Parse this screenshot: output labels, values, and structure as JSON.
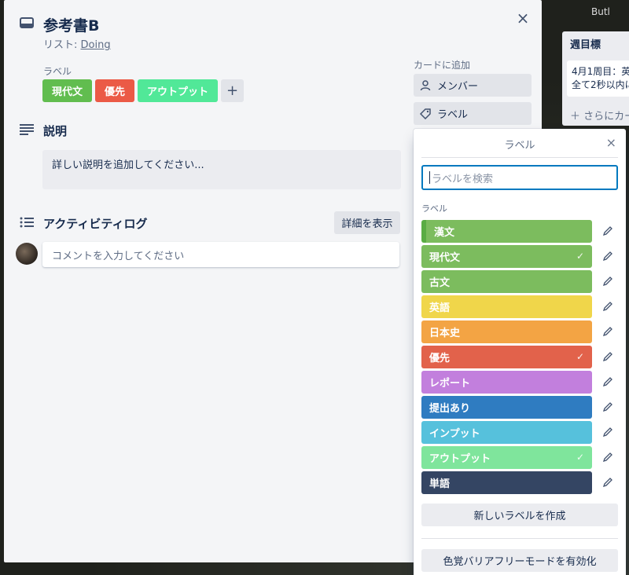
{
  "background": {
    "butler": "Butl",
    "list": {
      "title": "週目標",
      "card_text": "4月1周目：英\n全て2秒以内に",
      "add_card": "＋ さらにカー"
    }
  },
  "card": {
    "title": "参考書B",
    "list_prefix": "リスト: ",
    "list_name": "Doing",
    "labels_heading": "ラベル",
    "labels": [
      {
        "name": "現代文",
        "color": "#61bd4f"
      },
      {
        "name": "優先",
        "color": "#eb5a46"
      },
      {
        "name": "アウトプット",
        "color": "#51e898"
      }
    ],
    "add_label_symbol": "+",
    "description_title": "説明",
    "description_placeholder": "詳しい説明を追加してください...",
    "activity_title": "アクティビティログ",
    "show_details": "詳細を表示",
    "comment_placeholder": "コメントを入力してください",
    "close_symbol": "×"
  },
  "sidebar": {
    "heading": "カードに追加",
    "members": "メンバー",
    "labels": "ラベル"
  },
  "label_popover": {
    "title": "ラベル",
    "close_symbol": "×",
    "search_placeholder": "ラベルを検索",
    "section_heading": "ラベル",
    "items": [
      {
        "name": "漢文",
        "color": "#7cbc5e",
        "checked": false,
        "hovered": true
      },
      {
        "name": "現代文",
        "color": "#7cbc5e",
        "checked": true
      },
      {
        "name": "古文",
        "color": "#7cbc5e",
        "checked": false
      },
      {
        "name": "英語",
        "color": "#f0d64a",
        "checked": false
      },
      {
        "name": "日本史",
        "color": "#f3a444",
        "checked": false
      },
      {
        "name": "優先",
        "color": "#e2624b",
        "checked": true
      },
      {
        "name": "レポート",
        "color": "#c27fdd",
        "checked": false
      },
      {
        "name": "提出あり",
        "color": "#2f7cc1",
        "checked": false
      },
      {
        "name": "インプット",
        "color": "#56c1dc",
        "checked": false
      },
      {
        "name": "アウトプット",
        "color": "#7fe59c",
        "checked": true
      },
      {
        "name": "単語",
        "color": "#344563",
        "checked": false
      }
    ],
    "check_symbol": "✓",
    "create_label": "新しいラベルを作成",
    "colorblind_mode": "色覚バリアフリーモードを有効化"
  }
}
